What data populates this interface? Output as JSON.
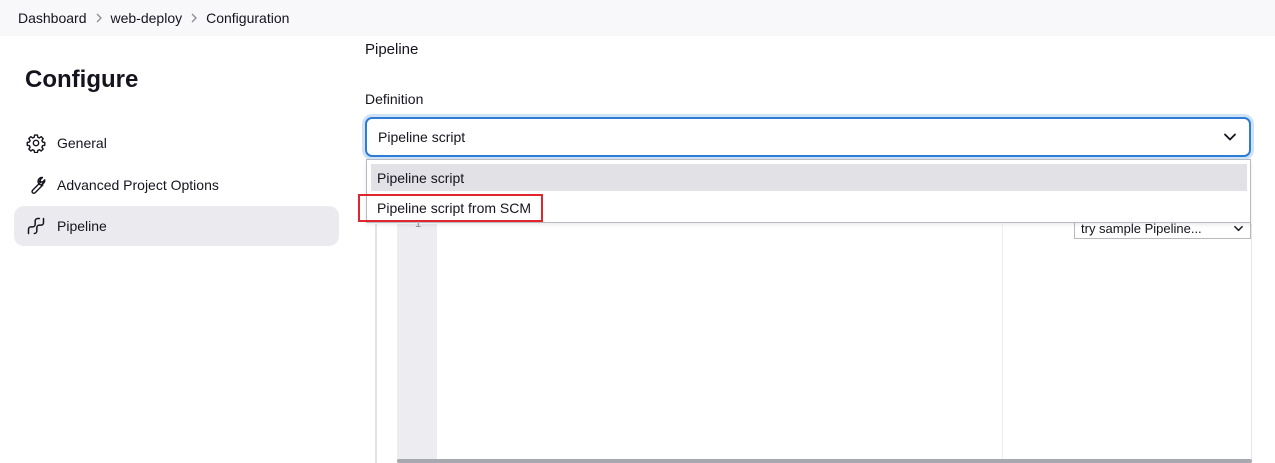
{
  "breadcrumb": {
    "items": [
      "Dashboard",
      "web-deploy",
      "Configuration"
    ],
    "separator_icon": "chevron-right-icon"
  },
  "sidebar": {
    "title": "Configure",
    "items": [
      {
        "label": "General",
        "icon": "gear-icon",
        "active": false
      },
      {
        "label": "Advanced Project Options",
        "icon": "wrench-icon",
        "active": false
      },
      {
        "label": "Pipeline",
        "icon": "pipeline-icon",
        "active": true
      }
    ]
  },
  "main": {
    "section_title": "Pipeline",
    "definition": {
      "label": "Definition",
      "selected_value": "Pipeline script",
      "options": [
        "Pipeline script",
        "Pipeline script from SCM"
      ],
      "highlighted_option": "Pipeline script from SCM"
    },
    "script_editor": {
      "gutter_mark": "1",
      "sample_select": "try sample Pipeline..."
    }
  },
  "colors": {
    "focus_border": "#2e7cd6",
    "annotation_box": "#e0262d",
    "active_item_bg": "#ebebef"
  }
}
